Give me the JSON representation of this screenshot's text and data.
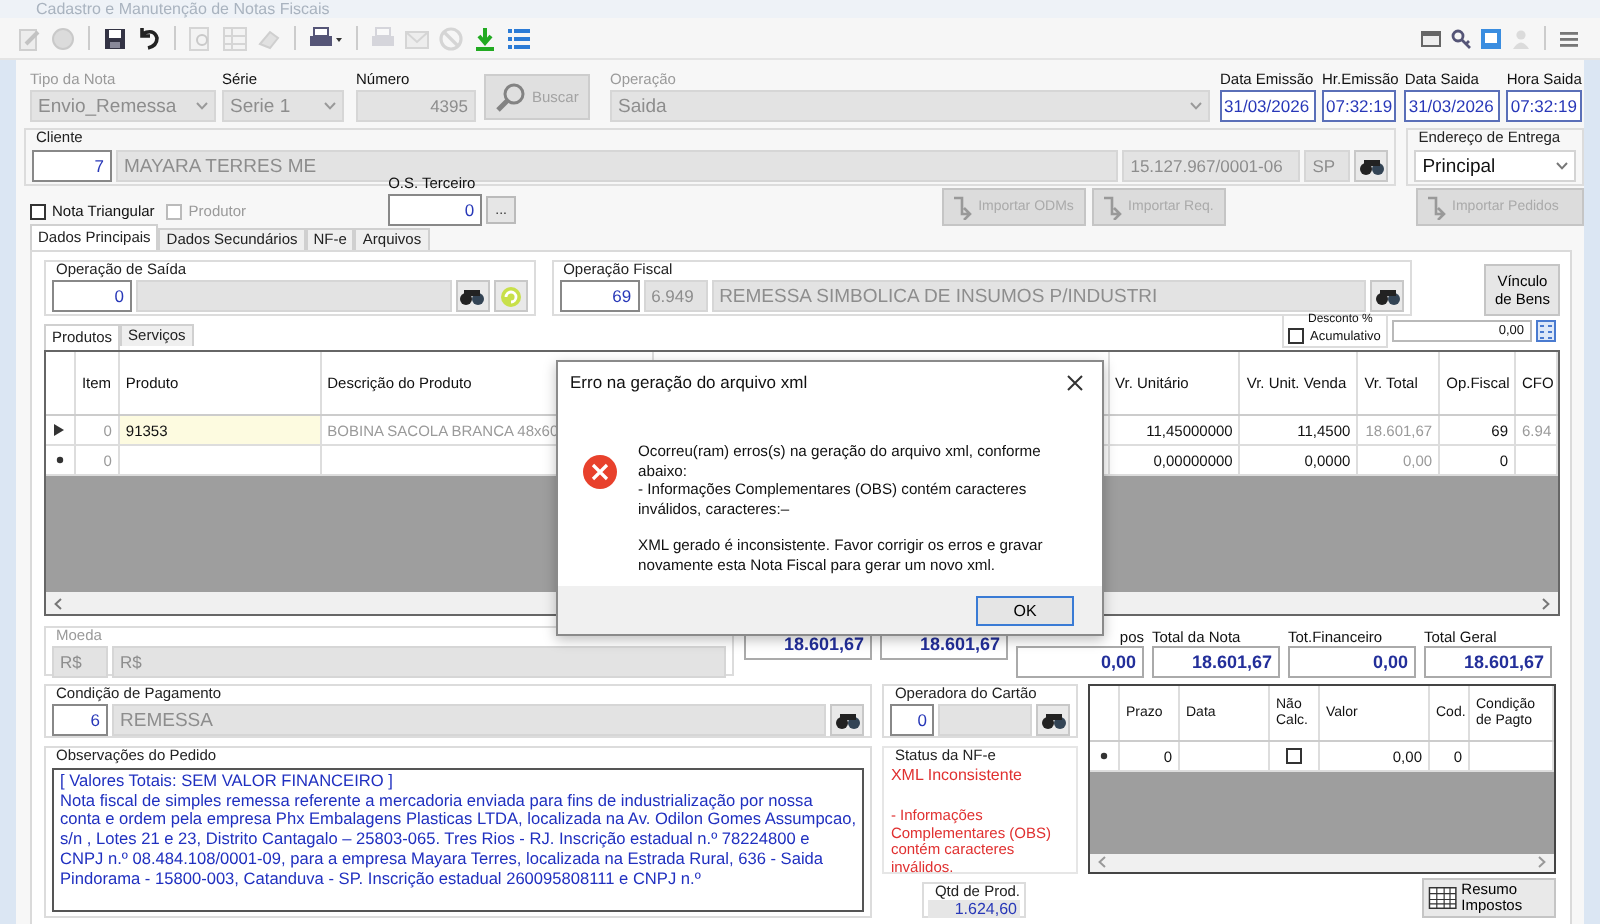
{
  "window": {
    "title": "Cadastro e Manutenção de Notas Fiscais"
  },
  "toolbar": [
    {
      "kind": "edit",
      "disabled": true
    },
    {
      "kind": "cancel",
      "disabled": true
    },
    {
      "kind": "separator"
    },
    {
      "kind": "save",
      "disabled": false
    },
    {
      "kind": "undo",
      "disabled": false
    },
    {
      "kind": "separator"
    },
    {
      "kind": "search",
      "disabled": true
    },
    {
      "kind": "grid",
      "disabled": true
    },
    {
      "kind": "eraser",
      "disabled": true
    },
    {
      "kind": "separator"
    },
    {
      "kind": "printer-menu",
      "disabled": false
    },
    {
      "kind": "separator"
    },
    {
      "kind": "printer",
      "disabled": true
    },
    {
      "kind": "mail",
      "disabled": true
    },
    {
      "kind": "block",
      "disabled": true
    },
    {
      "kind": "download",
      "disabled": false
    },
    {
      "kind": "list",
      "disabled": false
    }
  ],
  "toolbar_right": [
    {
      "kind": "window",
      "disabled": false
    },
    {
      "kind": "key",
      "disabled": false
    },
    {
      "kind": "screen",
      "disabled": false
    },
    {
      "kind": "user",
      "disabled": true
    },
    {
      "kind": "separator"
    },
    {
      "kind": "menu",
      "disabled": false
    }
  ],
  "header": {
    "tipo_nota": {
      "label": "Tipo da Nota",
      "value": "Envio_Remessa",
      "disabled": true
    },
    "serie": {
      "label": "Série",
      "value": "Serie 1",
      "disabled": true
    },
    "numero": {
      "label": "Número",
      "value": "4395",
      "disabled": true
    },
    "buscar": {
      "label": "Buscar",
      "disabled": true
    },
    "operacao": {
      "label": "Operação",
      "value": "Saida",
      "disabled": true
    },
    "dates": [
      {
        "label": "Data Emissão",
        "value": "31/03/2026"
      },
      {
        "label": "Hr.Emissão",
        "value": "07:32:19"
      },
      {
        "label": "Data Saida",
        "value": "31/03/2026"
      },
      {
        "label": "Hora Saida",
        "value": "07:32:19"
      }
    ]
  },
  "cliente": {
    "label": "Cliente",
    "code": "7",
    "name": "MAYARA TERRES ME",
    "cnpj": "15.127.967/0001-06",
    "uf": "SP"
  },
  "endereco_entrega": {
    "label": "Endereço de Entrega",
    "value": "Principal"
  },
  "options": [
    {
      "label": "Nota Triangular",
      "checked": false,
      "disabled": false
    },
    {
      "label": "Produtor",
      "checked": false,
      "disabled": true
    }
  ],
  "os_terceiro": {
    "label": "O.S. Terceiro",
    "value": "0",
    "button": "..."
  },
  "import_buttons": [
    {
      "label": "Importar ODMs",
      "disabled": true
    },
    {
      "label": "Importar Req.",
      "disabled": true
    },
    {
      "label": "Importar Pedidos",
      "disabled": true
    }
  ],
  "tabs": [
    {
      "label": "Dados Principais",
      "selected": true
    },
    {
      "label": "Dados Secundários",
      "selected": false
    },
    {
      "label": "NF-e",
      "selected": false
    },
    {
      "label": "Arquivos",
      "selected": false
    }
  ],
  "operacao_saida": {
    "label": "Operação de Saída",
    "code": "0"
  },
  "operacao_fiscal": {
    "label": "Operação Fiscal",
    "code": "69",
    "cfop": "6.949",
    "description": "REMESSA SIMBOLICA DE INSUMOS P/INDUSTRI"
  },
  "vinculo_button": "Vínculo de Bens",
  "desconto": {
    "label": "Desconto %",
    "option": {
      "label": "Acumulativo",
      "checked": false
    },
    "value": "0,00"
  },
  "subtabs": [
    {
      "label": "Produtos",
      "selected": true
    },
    {
      "label": "Serviços",
      "selected": false
    }
  ],
  "items_table": {
    "columns": [
      "Item",
      "Produto",
      "Descrição do Produto",
      "Vr. Unitário",
      "Vr. Unit. Venda",
      "Vr. Total",
      "Op.Fiscal",
      "CFO"
    ],
    "rows": [
      {
        "kind": "current",
        "cells": [
          "0",
          "91353",
          "BOBINA SACOLA BRANCA 48x60",
          "11,45000000",
          "11,4500",
          "18.601,67",
          "69",
          "6.94"
        ]
      },
      {
        "kind": "new",
        "cells": [
          "0",
          null,
          null,
          "0,00000000",
          "0,0000",
          "0,00",
          "0",
          null
        ]
      }
    ]
  },
  "dialog": {
    "title": "Erro na geração do arquivo xml",
    "details": [
      "Ocorreu(ram) erros(s) na geração do arquivo xml, conforme abaixo:",
      " - Informações Complementares (OBS) contém caracteres inválidos, caracteres:–"
    ],
    "conclusion": "XML gerado é inconsistente. Favor corrigir os erros e gravar novamente esta Nota Fiscal para gerar um novo xml.",
    "button": "OK"
  },
  "totals": {
    "moeda": {
      "label": "Moeda",
      "code": "R$",
      "name": "R$"
    },
    "boxes": [
      {
        "value": "18.601,67"
      },
      {
        "value": "18.601,67"
      },
      {
        "label": "pos",
        "value": "0,00"
      },
      {
        "label": "Total da Nota",
        "value": "18.601,67"
      },
      {
        "label": "Tot.Financeiro",
        "value": "0,00"
      },
      {
        "label": "Total Geral",
        "value": "18.601,67"
      }
    ]
  },
  "condicao_pagamento": {
    "label": "Condição de Pagamento",
    "code": "6",
    "name": "REMESSA"
  },
  "operadora_cartao": {
    "label": "Operadora do Cartão",
    "code": "0"
  },
  "parcelas_table": {
    "columns": [
      "Prazo",
      "Data",
      "Não Calc.",
      "Valor",
      "Cod.",
      "Condição de Pagto"
    ],
    "rows": [
      {
        "prazo": "0",
        "nao_calc": false,
        "valor": "0,00",
        "cod": "0"
      }
    ]
  },
  "observacoes": {
    "label": "Observações do Pedido",
    "heading": "[ Valores Totais: SEM VALOR FINANCEIRO ]",
    "text": "Nota fiscal de simples remessa referente a mercadoria enviada para fins de industrialização por nossa conta e ordem pela empresa Phx Embalagens Plasticas LTDA, localizada na Av. Odilon Gomes Assumpcao, s/n , Lotes 21  e 23, Distrito Cantagalo – 25803-065. Tres Rios - RJ. Inscrição estadual n.º 78224800 e CNPJ n.º 08.484.108/0001-09, para a empresa Mayara Terres, localizada na Estrada Rural, 636 - Saida Pindorama - 15800-003, Catanduva - SP. Inscrição estadual 260095808111 e CNPJ n.º"
  },
  "status_nfe": {
    "label": "Status da NF-e",
    "status": "XML Inconsistente",
    "detail": "- Informações Complementares (OBS) contém caracteres inválidos."
  },
  "qtd_prod": {
    "label": "Qtd de Prod.",
    "value": "1.624,60"
  },
  "resumo_button": "Resumo Impostos"
}
